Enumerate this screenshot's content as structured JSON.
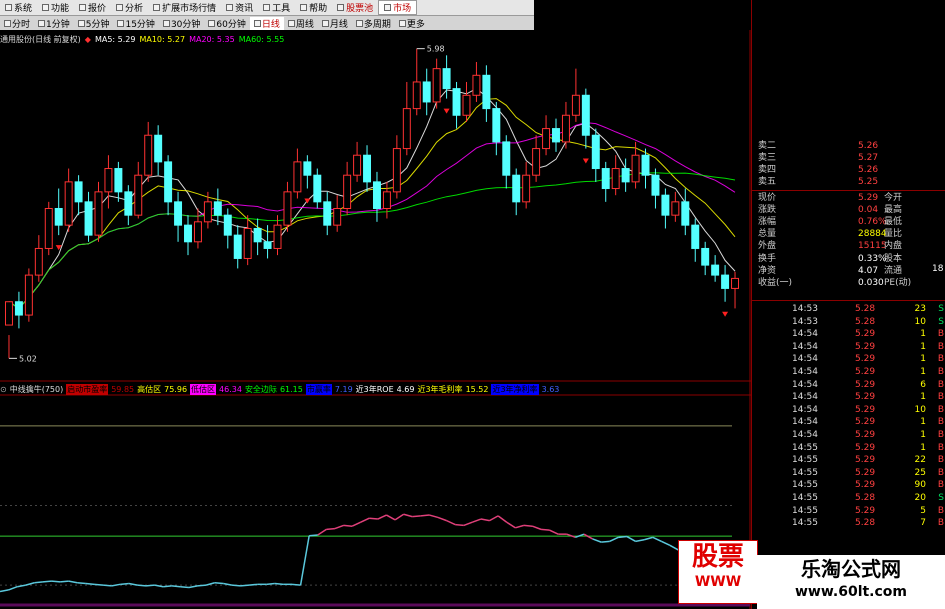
{
  "menu": [
    {
      "label": "系统",
      "red": false,
      "sel": false
    },
    {
      "label": "功能",
      "red": false,
      "sel": false
    },
    {
      "label": "报价",
      "red": false,
      "sel": false
    },
    {
      "label": "分析",
      "red": false,
      "sel": false
    },
    {
      "label": "扩展市场行情",
      "red": false,
      "sel": false
    },
    {
      "label": "资讯",
      "red": false,
      "sel": false
    },
    {
      "label": "工具",
      "red": false,
      "sel": false
    },
    {
      "label": "帮助",
      "red": false,
      "sel": false
    },
    {
      "label": "股票池",
      "red": true,
      "sel": false
    },
    {
      "label": "市场",
      "red": true,
      "sel": true
    }
  ],
  "periods": [
    "分时",
    "1分钟",
    "5分钟",
    "15分钟",
    "30分钟",
    "60分钟",
    "日线",
    "周线",
    "月线",
    "多周期",
    "更多"
  ],
  "selected_period": "日线",
  "stock_title": "通用股份(日线 前复权)",
  "ma_legend": [
    {
      "label": "MA5: 5.29",
      "color": "#ffffff"
    },
    {
      "label": "MA10: 5.27",
      "color": "#ffff00"
    },
    {
      "label": "MA20: 5.35",
      "color": "#ff00ff"
    },
    {
      "label": "MA60: 5.55",
      "color": "#00ff00"
    }
  ],
  "price_annotations": {
    "high": "5.98",
    "low": "5.02"
  },
  "price_axis": [
    "5.80",
    "5.60",
    "5.40",
    "5.30",
    "5.20",
    "5.10"
  ],
  "indicator": {
    "name": "中线擒牛(750)",
    "items": [
      {
        "label": "启动市盈率",
        "value": "59.85",
        "bg": "#c00000",
        "fg": "#000"
      },
      {
        "label": "高估区",
        "value": "75.96",
        "bg": null,
        "fg": "#ffff00"
      },
      {
        "label": "低估区",
        "value": "46.34",
        "bg": "#ff00ff",
        "fg": "#000"
      },
      {
        "label": "安全边际",
        "value": "61.15",
        "bg": null,
        "fg": "#00ff00"
      },
      {
        "label": "市赢率",
        "value": "7.19",
        "bg": "#0000ff",
        "fg": "#000"
      },
      {
        "label": "近3年ROE",
        "value": "4.69",
        "bg": null,
        "fg": "#ffffff"
      },
      {
        "label": "近3年毛利率",
        "value": "15.52",
        "bg": null,
        "fg": "#ffff00"
      },
      {
        "label": "近3年净利率",
        "value": "3.63",
        "bg": "#0000ff",
        "fg": "#000"
      }
    ],
    "axis": [
      "75.00",
      "68.72",
      "65.00",
      "60.00",
      "55.00"
    ],
    "current": "68.72"
  },
  "order_book": [
    {
      "label": "卖二",
      "price": "5.26"
    },
    {
      "label": "卖三",
      "price": "5.27"
    },
    {
      "label": "卖四",
      "price": "5.26"
    },
    {
      "label": "卖五",
      "price": "5.25"
    }
  ],
  "quote_rows": [
    {
      "l1": "现价",
      "v1": "5.29",
      "l2": "今开",
      "v1c": "#ff4040"
    },
    {
      "l1": "涨跌",
      "v1": "0.04",
      "l2": "最高",
      "v1c": "#ff4040"
    },
    {
      "l1": "涨幅",
      "v1": "0.76%",
      "l2": "最低",
      "v1c": "#ff4040"
    },
    {
      "l1": "总量",
      "v1": "28884",
      "l2": "量比",
      "v1c": "#ffff00"
    },
    {
      "l1": "外盘",
      "v1": "15115",
      "l2": "内盘",
      "v1c": "#ff4040"
    },
    {
      "l1": "换手",
      "v1": "0.33%",
      "l2": "股本",
      "v1c": "#ffffff"
    },
    {
      "l1": "净资",
      "v1": "4.07",
      "l2": "流通",
      "v1c": "#ffffff"
    },
    {
      "l1": "收益(一)",
      "v1": "0.030",
      "l2": "PE(动)",
      "v1c": "#ffffff"
    }
  ],
  "quote_extra": "18",
  "ticks": [
    {
      "time": "14:53",
      "price": "5.28",
      "vol": "23",
      "side": "S"
    },
    {
      "time": "14:53",
      "price": "5.28",
      "vol": "10",
      "side": "S"
    },
    {
      "time": "14:54",
      "price": "5.29",
      "vol": "1",
      "side": "B"
    },
    {
      "time": "14:54",
      "price": "5.29",
      "vol": "1",
      "side": "B"
    },
    {
      "time": "14:54",
      "price": "5.29",
      "vol": "1",
      "side": "B"
    },
    {
      "time": "14:54",
      "price": "5.29",
      "vol": "1",
      "side": "B"
    },
    {
      "time": "14:54",
      "price": "5.29",
      "vol": "6",
      "side": "B"
    },
    {
      "time": "14:54",
      "price": "5.29",
      "vol": "1",
      "side": "B"
    },
    {
      "time": "14:54",
      "price": "5.29",
      "vol": "10",
      "side": "B"
    },
    {
      "time": "14:54",
      "price": "5.29",
      "vol": "1",
      "side": "B"
    },
    {
      "time": "14:54",
      "price": "5.29",
      "vol": "1",
      "side": "B"
    },
    {
      "time": "14:55",
      "price": "5.29",
      "vol": "1",
      "side": "B"
    },
    {
      "time": "14:55",
      "price": "5.29",
      "vol": "22",
      "side": "B"
    },
    {
      "time": "14:55",
      "price": "5.29",
      "vol": "25",
      "side": "B"
    },
    {
      "time": "14:55",
      "price": "5.29",
      "vol": "90",
      "side": "B"
    },
    {
      "time": "14:55",
      "price": "5.28",
      "vol": "20",
      "side": "S"
    },
    {
      "time": "14:55",
      "price": "5.29",
      "vol": "5",
      "side": "B"
    },
    {
      "time": "14:55",
      "price": "5.28",
      "vol": "7",
      "side": "B"
    }
  ],
  "watermark": {
    "logo": "股票",
    "logo_sub": "WWW",
    "site": "乐淘公式网",
    "url": "www.60lt.com"
  },
  "chart_data": {
    "type": "candlestick",
    "price_range": [
      5.02,
      5.98
    ],
    "candles": [
      [
        5.15,
        5.22,
        5.12,
        5.05
      ],
      [
        5.22,
        5.18,
        5.25,
        5.14
      ],
      [
        5.18,
        5.3,
        5.32,
        5.16
      ],
      [
        5.3,
        5.38,
        5.42,
        5.28
      ],
      [
        5.38,
        5.5,
        5.52,
        5.36
      ],
      [
        5.5,
        5.45,
        5.56,
        5.42
      ],
      [
        5.45,
        5.58,
        5.62,
        5.43
      ],
      [
        5.58,
        5.52,
        5.6,
        5.48
      ],
      [
        5.52,
        5.42,
        5.55,
        5.4
      ],
      [
        5.42,
        5.55,
        5.58,
        5.4
      ],
      [
        5.55,
        5.62,
        5.66,
        5.5
      ],
      [
        5.62,
        5.55,
        5.64,
        5.52
      ],
      [
        5.55,
        5.48,
        5.57,
        5.45
      ],
      [
        5.48,
        5.6,
        5.64,
        5.47
      ],
      [
        5.6,
        5.72,
        5.76,
        5.58
      ],
      [
        5.72,
        5.64,
        5.75,
        5.6
      ],
      [
        5.64,
        5.52,
        5.66,
        5.48
      ],
      [
        5.52,
        5.45,
        5.55,
        5.4
      ],
      [
        5.45,
        5.4,
        5.48,
        5.36
      ],
      [
        5.4,
        5.46,
        5.5,
        5.38
      ],
      [
        5.46,
        5.52,
        5.55,
        5.44
      ],
      [
        5.52,
        5.48,
        5.56,
        5.45
      ],
      [
        5.48,
        5.42,
        5.5,
        5.38
      ],
      [
        5.42,
        5.35,
        5.45,
        5.32
      ],
      [
        5.35,
        5.44,
        5.48,
        5.33
      ],
      [
        5.44,
        5.4,
        5.47,
        5.36
      ],
      [
        5.4,
        5.38,
        5.45,
        5.35
      ],
      [
        5.38,
        5.45,
        5.48,
        5.36
      ],
      [
        5.45,
        5.55,
        5.58,
        5.43
      ],
      [
        5.55,
        5.64,
        5.68,
        5.53
      ],
      [
        5.64,
        5.6,
        5.66,
        5.56
      ],
      [
        5.6,
        5.52,
        5.62,
        5.5
      ],
      [
        5.52,
        5.45,
        5.55,
        5.42
      ],
      [
        5.45,
        5.5,
        5.54,
        5.43
      ],
      [
        5.5,
        5.6,
        5.64,
        5.48
      ],
      [
        5.6,
        5.66,
        5.7,
        5.58
      ],
      [
        5.66,
        5.58,
        5.69,
        5.55
      ],
      [
        5.58,
        5.5,
        5.61,
        5.46
      ],
      [
        5.5,
        5.55,
        5.58,
        5.47
      ],
      [
        5.55,
        5.68,
        5.72,
        5.53
      ],
      [
        5.68,
        5.8,
        5.88,
        5.66
      ],
      [
        5.8,
        5.88,
        5.98,
        5.78
      ],
      [
        5.88,
        5.82,
        5.92,
        5.78
      ],
      [
        5.82,
        5.92,
        5.95,
        5.8
      ],
      [
        5.92,
        5.86,
        5.96,
        5.83
      ],
      [
        5.86,
        5.78,
        5.88,
        5.74
      ],
      [
        5.78,
        5.84,
        5.88,
        5.76
      ],
      [
        5.84,
        5.9,
        5.94,
        5.82
      ],
      [
        5.9,
        5.8,
        5.93,
        5.76
      ],
      [
        5.8,
        5.7,
        5.82,
        5.66
      ],
      [
        5.7,
        5.6,
        5.72,
        5.56
      ],
      [
        5.6,
        5.52,
        5.62,
        5.48
      ],
      [
        5.52,
        5.6,
        5.64,
        5.5
      ],
      [
        5.6,
        5.68,
        5.72,
        5.58
      ],
      [
        5.68,
        5.74,
        5.78,
        5.66
      ],
      [
        5.74,
        5.7,
        5.77,
        5.67
      ],
      [
        5.7,
        5.78,
        5.82,
        5.68
      ],
      [
        5.78,
        5.84,
        5.92,
        5.76
      ],
      [
        5.84,
        5.72,
        5.86,
        5.68
      ],
      [
        5.72,
        5.62,
        5.74,
        5.58
      ],
      [
        5.62,
        5.56,
        5.64,
        5.52
      ],
      [
        5.56,
        5.62,
        5.66,
        5.54
      ],
      [
        5.62,
        5.58,
        5.65,
        5.55
      ],
      [
        5.58,
        5.66,
        5.7,
        5.56
      ],
      [
        5.66,
        5.6,
        5.68,
        5.56
      ],
      [
        5.6,
        5.54,
        5.62,
        5.5
      ],
      [
        5.54,
        5.48,
        5.56,
        5.44
      ],
      [
        5.48,
        5.52,
        5.55,
        5.46
      ],
      [
        5.52,
        5.45,
        5.56,
        5.42
      ],
      [
        5.45,
        5.38,
        5.47,
        5.34
      ],
      [
        5.38,
        5.33,
        5.4,
        5.3
      ],
      [
        5.33,
        5.3,
        5.36,
        5.28
      ],
      [
        5.3,
        5.26,
        5.33,
        5.22
      ],
      [
        5.26,
        5.29,
        5.31,
        5.2
      ]
    ],
    "indicator_line": [
      54.2,
      54.4,
      54.8,
      55.0,
      55.3,
      55.4,
      55.5,
      55.4,
      55.5,
      55.3,
      55.2,
      55.1,
      55.0,
      54.9,
      55.1,
      55.2,
      55.0,
      54.9,
      55.0,
      54.8,
      54.9,
      54.8,
      54.7,
      54.9,
      55.0,
      55.3,
      55.2,
      55.0,
      54.9,
      55.0,
      55.1,
      55.1,
      55.2,
      55.1,
      55.1,
      55.0,
      61.2,
      61.3,
      62.0,
      62.1,
      62.5,
      62.4,
      62.9,
      63.4,
      63.3,
      63.8,
      63.2,
      63.9,
      63.6,
      63.7,
      63.8,
      63.5,
      63.1,
      62.6,
      62.5,
      62.9,
      63.3,
      63.1,
      63.7,
      62.9,
      62.2,
      62.5,
      62.4,
      62.0,
      61.9,
      61.4,
      61.4,
      61.0,
      61.4,
      60.8,
      60.4,
      60.5,
      61.0,
      61.1,
      60.5,
      60.7,
      61.0,
      60.5,
      60.0,
      59.4,
      60.1,
      59.2,
      59.9,
      59.5,
      59.8,
      59.7
    ],
    "indicator_break": 36,
    "safety_line": 61.15,
    "indicator_range": [
      52,
      78
    ]
  }
}
